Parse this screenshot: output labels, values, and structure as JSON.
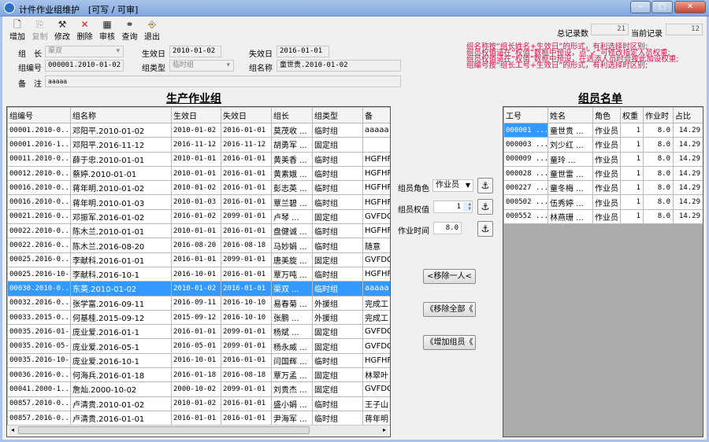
{
  "window": {
    "title": "计件作业组维护",
    "mode": "[可写 / 可审]",
    "buttons": [
      "–",
      "□",
      "✕"
    ]
  },
  "toolbar": [
    {
      "label": "增加",
      "icon": "new-doc-icon",
      "disabled": false
    },
    {
      "label": "复制",
      "icon": "copy-icon",
      "disabled": true
    },
    {
      "label": "修改",
      "icon": "edit-tools-icon",
      "disabled": false
    },
    {
      "label": "删除",
      "icon": "delete-x-icon",
      "disabled": false
    },
    {
      "label": "审核",
      "icon": "audit-icon",
      "disabled": false
    },
    {
      "label": "查询",
      "icon": "binoculars-icon",
      "disabled": false
    },
    {
      "label": "退出",
      "icon": "exit-door-icon",
      "disabled": false
    }
  ],
  "records": {
    "total_label": "总记录数",
    "total": "21",
    "current_label": "当前记录",
    "current": "12"
  },
  "form": {
    "leader_label": "组　长",
    "leader": "渠双",
    "start_label": "生效日",
    "start": "2010-01-02",
    "end_label": "失效日",
    "end": "2016-01-01",
    "code_label": "组编号",
    "code": "000001.2010-01-02",
    "type_label": "组类型",
    "type": "临时组",
    "name_label": "组名称",
    "name": "童世贵.2010-01-02",
    "remark_label": "备　注",
    "remark": "aaaaa"
  },
  "notes": [
    "组名称按“组长姓名+生效日”的形式，有利选择时区别;",
    "组员权值请在“权值”数框中预设，点“↙”可修改指定人员权重;",
    "组员权值请在“权值”数框中预设，在选添人员时会按此加设权重;",
    "组编号按“组长工号+生效日”的形式，有利选择时区别;"
  ],
  "groups": {
    "title": "生产作业组",
    "columns": [
      "组编号",
      "组名称",
      "生效日",
      "失效日",
      "组长",
      "组类型",
      "备"
    ],
    "selected_index": 11,
    "rows": [
      [
        "00001.2010-0...",
        "邓阳平.2010-01-02",
        "2010-01-02",
        "2016-01-01",
        "莫茂收 ...",
        "临时组",
        "aaaaa"
      ],
      [
        "00001.2016-1...",
        "邓阳平.2016-11-12",
        "2016-11-12",
        "2016-11-12",
        "胡勇军 ...",
        "固定组",
        ""
      ],
      [
        "00011.2010-0...",
        "薛于忠.2010-01-01",
        "2010-01-01",
        "2016-01-01",
        "黄美香 ...",
        "临时组",
        "HGFHFG"
      ],
      [
        "00012.2010-0...",
        "蔡婷.2010-01-01",
        "2010-01-01",
        "2016-01-01",
        "黄素娥 ...",
        "临时组",
        "HGFHFG"
      ],
      [
        "00016.2010-0...",
        "蒋年明.2010-01-02",
        "2010-01-02",
        "2016-01-01",
        "彭志英 ...",
        "临时组",
        "HGFHFG"
      ],
      [
        "00016.2010-0...",
        "蒋年明.2010-01-03",
        "2010-01-03",
        "2016-01-01",
        "覃兰碧 ...",
        "临时组",
        "HGFHFG"
      ],
      [
        "00021.2016-0...",
        "邓振军.2016-01-02",
        "2016-01-02",
        "2099-01-01",
        "卢琴   ...",
        "固定组",
        "GVFDGF"
      ],
      [
        "00022.2010-0...",
        "陈木兰.2010-01-01",
        "2010-01-01",
        "2016-01-01",
        "盘健诚 ...",
        "临时组",
        "HGFHFG"
      ],
      [
        "00022.2016-0...",
        "陈木兰.2016-08-20",
        "2016-08-20",
        "2016-08-18",
        "马妙娟 ...",
        "临时组",
        "随意"
      ],
      [
        "00025.2016-0...",
        "李献科.2016-01-01",
        "2016-01-01",
        "2099-01-01",
        "唐美旋 ...",
        "固定组",
        "GVFDGF"
      ],
      [
        "00025.2016-10-1",
        "李献科.2016-10-1",
        "2016-10-01",
        "2016-01-01",
        "覃万吨 ...",
        "临时组",
        "HGFHFG"
      ],
      [
        "00030.2010-0...",
        "东英.2010-01-02",
        "2010-01-02",
        "2016-01-01",
        "渠双   ...",
        "临时组",
        "aaaaa"
      ],
      [
        "00032.2016-0...",
        "张学富.2016-09-11",
        "2016-09-11",
        "2016-10-10",
        "易春菊 ...",
        "外援组",
        "完成工"
      ],
      [
        "00033.2015-0...",
        "何基桂.2015-09-12",
        "2015-09-12",
        "2016-10-10",
        "张鹏   ...",
        "外援组",
        "完成工"
      ],
      [
        "00035.2016-01-1",
        "庞业爱.2016-01-1",
        "2016-01-01",
        "2099-01-01",
        "杨斌   ...",
        "固定组",
        "GVFDGF"
      ],
      [
        "00035.2016-05-1",
        "庞业爱.2016-05-1",
        "2016-05-01",
        "2099-01-01",
        "杨永威 ...",
        "固定组",
        "GVFDGF"
      ],
      [
        "00035.2016-10-1",
        "庞业爱.2016-10-1",
        "2016-10-01",
        "2016-01-01",
        "闫国辉 ...",
        "临时组",
        "HGFHFG"
      ],
      [
        "00036.2016-0...",
        "何海兵.2016-01-18",
        "2016-01-18",
        "2016-08-18",
        "覃万孟 ...",
        "固定组",
        "林翠叶"
      ],
      [
        "00041.2000-1...",
        "詹灿.2000-10-02",
        "2000-10-02",
        "2099-01-01",
        "刘贵杰 ...",
        "固定组",
        "GVFDGF"
      ],
      [
        "00857.2010-0...",
        "卢清贵.2010-01-02",
        "2010-01-02",
        "2016-01-01",
        "盛小娟 ...",
        "临时组",
        "王子山"
      ],
      [
        "00857.2016-0...",
        "卢清贵.2016-01-01",
        "2016-01-01",
        "2016-01-01",
        "尹海军 ...",
        "临时组",
        "蒋年明"
      ]
    ]
  },
  "controls": {
    "role_label": "组员角色",
    "role": "作业员",
    "weight_label": "组员权值",
    "weight": "1",
    "hours_label": "作业时间",
    "hours": "8.0",
    "remove_one": "<移除一人<",
    "remove_all": "《移除全部《",
    "add_members": "《增加组员《"
  },
  "members": {
    "title": "组员名单",
    "columns": [
      "工号",
      "姓名",
      "角色",
      "权重",
      "作业时",
      "占比"
    ],
    "rows": [
      [
        "000001 ...",
        "童世贵 ...",
        "作业员",
        "1",
        "8.0",
        "14.29"
      ],
      [
        "000003 ...",
        "刘少红 ...",
        "作业员",
        "1",
        "8.0",
        "14.29"
      ],
      [
        "000009 ...",
        "童玲   ...",
        "作业员",
        "1",
        "8.0",
        "14.29"
      ],
      [
        "000028 ...",
        "童世雷 ...",
        "作业员",
        "1",
        "8.0",
        "14.29"
      ],
      [
        "000227 ...",
        "童冬梅 ...",
        "作业员",
        "1",
        "8.0",
        "14.29"
      ],
      [
        "000502 ...",
        "伍秀婷 ...",
        "作业员",
        "1",
        "8.0",
        "14.29"
      ],
      [
        "000552 ...",
        "林燕珊 ...",
        "作业员",
        "1",
        "8.0",
        "14.29"
      ]
    ]
  },
  "colors": {
    "selection": "#3399ff",
    "note": "#e0104a",
    "titlebar": "#a9c4ea"
  }
}
